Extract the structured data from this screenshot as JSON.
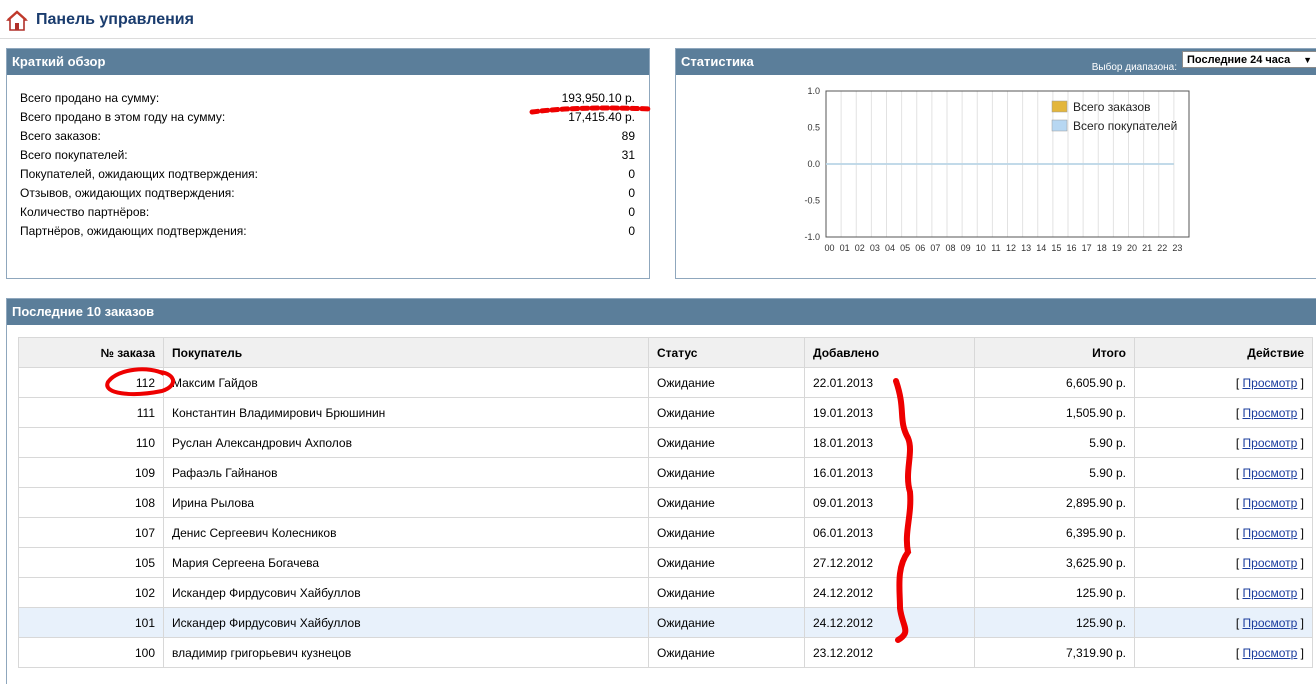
{
  "header": {
    "title": "Панель управления",
    "icon": "home-icon"
  },
  "overview": {
    "title": "Краткий обзор",
    "rows": [
      {
        "label": "Всего продано на сумму:",
        "value": "193,950.10 р."
      },
      {
        "label": "Всего продано в этом году на сумму:",
        "value": "17,415.40 р."
      },
      {
        "label": "Всего заказов:",
        "value": "89"
      },
      {
        "label": "Всего покупателей:",
        "value": "31"
      },
      {
        "label": "Покупателей, ожидающих подтверждения:",
        "value": "0"
      },
      {
        "label": "Отзывов, ожидающих подтверждения:",
        "value": "0"
      },
      {
        "label": "Количество партнёров:",
        "value": "0"
      },
      {
        "label": "Партнёров, ожидающих подтверждения:",
        "value": "0"
      }
    ]
  },
  "stats": {
    "title": "Статистика",
    "range_label": "Выбор диапазона:",
    "range_value": "Последние 24 часа"
  },
  "chart_data": {
    "type": "line",
    "x": [
      "00",
      "01",
      "02",
      "03",
      "04",
      "05",
      "06",
      "07",
      "08",
      "09",
      "10",
      "11",
      "12",
      "13",
      "14",
      "15",
      "16",
      "17",
      "18",
      "19",
      "20",
      "21",
      "22",
      "23"
    ],
    "ylim": [
      -1.0,
      1.0
    ],
    "yticks": [
      "1.0",
      "0.5",
      "0.0",
      "-0.5",
      "-1.0"
    ],
    "grid": true,
    "legend": "top-right",
    "series": [
      {
        "name": "Всего заказов",
        "color": "#e3b63c",
        "values": [
          0,
          0,
          0,
          0,
          0,
          0,
          0,
          0,
          0,
          0,
          0,
          0,
          0,
          0,
          0,
          0,
          0,
          0,
          0,
          0,
          0,
          0,
          0,
          0
        ]
      },
      {
        "name": "Всего покупателей",
        "color": "#b7d7f2",
        "values": [
          0,
          0,
          0,
          0,
          0,
          0,
          0,
          0,
          0,
          0,
          0,
          0,
          0,
          0,
          0,
          0,
          0,
          0,
          0,
          0,
          0,
          0,
          0,
          0
        ]
      }
    ]
  },
  "orders": {
    "title": "Последние 10 заказов",
    "columns": [
      "№ заказа",
      "Покупатель",
      "Статус",
      "Добавлено",
      "Итого",
      "Действие"
    ],
    "action_label": "Просмотр",
    "rows": [
      {
        "id": "112",
        "customer": "Максим Гайдов",
        "status": "Ожидание",
        "date": "22.01.2013",
        "total": "6,605.90 р."
      },
      {
        "id": "111",
        "customer": "Константин Владимирович Брюшинин",
        "status": "Ожидание",
        "date": "19.01.2013",
        "total": "1,505.90 р."
      },
      {
        "id": "110",
        "customer": "Руслан Александрович Ахполов",
        "status": "Ожидание",
        "date": "18.01.2013",
        "total": "5.90 р."
      },
      {
        "id": "109",
        "customer": "Рафаэль Гайнанов",
        "status": "Ожидание",
        "date": "16.01.2013",
        "total": "5.90 р."
      },
      {
        "id": "108",
        "customer": "Ирина Рылова",
        "status": "Ожидание",
        "date": "09.01.2013",
        "total": "2,895.90 р."
      },
      {
        "id": "107",
        "customer": "Денис Сергеевич Колесников",
        "status": "Ожидание",
        "date": "06.01.2013",
        "total": "6,395.90 р."
      },
      {
        "id": "105",
        "customer": "Мария Сергеена Богачева",
        "status": "Ожидание",
        "date": "27.12.2012",
        "total": "3,625.90 р."
      },
      {
        "id": "102",
        "customer": "Искандер Фирдусович Хайбуллов",
        "status": "Ожидание",
        "date": "24.12.2012",
        "total": "125.90 р."
      },
      {
        "id": "101",
        "customer": "Искандер Фирдусович Хайбуллов",
        "status": "Ожидание",
        "date": "24.12.2012",
        "total": "125.90 р."
      },
      {
        "id": "100",
        "customer": "владимир григорьевич кузнецов",
        "status": "Ожидание",
        "date": "23.12.2012",
        "total": "7,319.90 р."
      }
    ]
  }
}
